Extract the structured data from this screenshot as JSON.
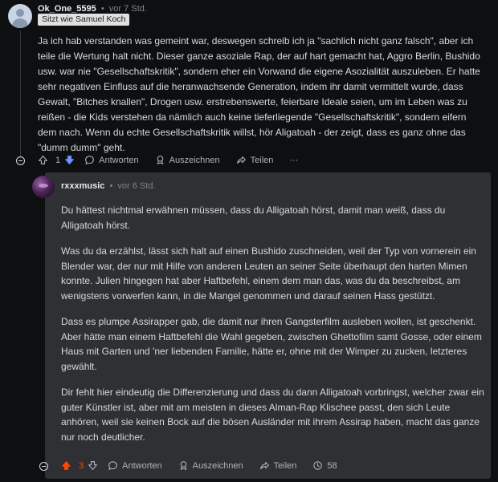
{
  "comment": {
    "username": "Ok_One_5595",
    "time": "vor 7 Std.",
    "flair": "Sitzt wie Samuel Koch",
    "text": "Ja ich hab verstanden was gemeint war, deswegen schreib ich ja \"sachlich nicht ganz falsch\", aber ich teile die Wertung halt nicht. Dieser ganze asoziale Rap, der auf hart gemacht hat, Aggro Berlin, Bushido usw. war nie \"Gesellschaftskritik\", sondern eher ein Vorwand die eigene Asozialität auszuleben. Er hatte sehr negativen Einfluss auf die heranwachsende Generation, indem ihr damit vermittelt wurde, dass Gewalt, \"Bitches knallen\", Drogen usw. erstrebenswerte, feierbare Ideale seien, um im Leben was zu reißen - die Kids verstehen da nämlich auch keine tieferliegende \"Gesellschaftskritik\", sondern eifern dem nach. Wenn du echte Gesellschaftskritik willst, hör Aligatoah - der zeigt, dass es ganz ohne das \"dumm dumm\" geht.",
    "actions": {
      "vote_count": "1",
      "reply": "Antworten",
      "award": "Auszeichnen",
      "share": "Teilen",
      "more": "···"
    }
  },
  "reply": {
    "username": "rxxxmusic",
    "time": "vor 6 Std.",
    "paragraphs": [
      "Du hättest nichtmal erwähnen müssen, dass du Alligatoah hörst, damit man weiß, dass du Alligatoah hörst.",
      "Was du da erzählst, lässt sich halt auf einen Bushido zuschneiden, weil der Typ von vornerein ein Blender war, der nur mit Hilfe von anderen Leuten an seiner Seite überhaupt den harten Mimen konnte. Julien hingegen hat aber Haftbefehl, einem dem man das, was du da beschreibst, am wenigstens vorwerfen kann, in die Mangel genommen und darauf seinen Hass gestützt.",
      "Dass es plumpe Assirapper gab, die damit nur ihren Gangsterfilm ausleben wollen, ist geschenkt. Aber hätte man einem Haftbefehl die Wahl gegeben, zwischen Ghettofilm samt Gosse, oder einem Haus mit Garten und 'ner liebenden Familie, hätte er, ohne mit der Wimper zu zucken, letzteres gewählt.",
      "Dir fehlt hier eindeutig die Differenzierung und dass du dann Alligatoah vorbringst, welcher zwar ein guter Künstler ist, aber mit am meisten in dieses Alman-Rap Klischee passt, den sich Leute anhören, weil sie keinen Bock auf die bösen Ausländer mit ihrem Assirap haben, macht das ganze nur noch deutlicher."
    ],
    "actions": {
      "vote_count": "3",
      "reply": "Antworten",
      "award": "Auszeichnen",
      "share": "Teilen",
      "awards_count": "58"
    }
  },
  "colors": {
    "upvote_active": "#ff4500",
    "downvote_active": "#7193ff",
    "card_bg": "#2e3033",
    "page_bg": "#0e0f10"
  }
}
